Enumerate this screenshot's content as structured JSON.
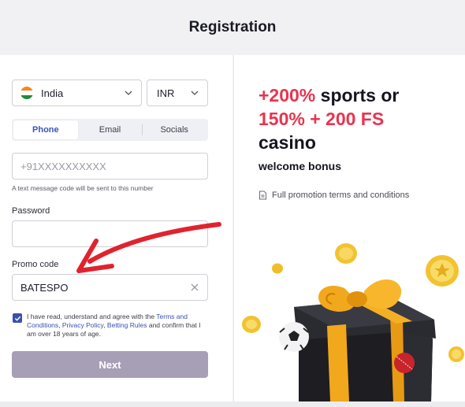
{
  "header": {
    "title": "Registration"
  },
  "country": {
    "value": "India",
    "flag": "india-flag-icon"
  },
  "currency": {
    "value": "INR"
  },
  "tabs": [
    {
      "label": "Phone",
      "active": true
    },
    {
      "label": "Email",
      "active": false
    },
    {
      "label": "Socials",
      "active": false
    }
  ],
  "phone": {
    "placeholder": "+91XXXXXXXXXX",
    "hint": "A text message code will be sent to this number"
  },
  "password": {
    "label": "Password",
    "value": ""
  },
  "promo": {
    "label": "Promo code",
    "value": "BATESPO"
  },
  "terms": {
    "checked": true,
    "prefix": "I have read, understand and agree with the ",
    "link_terms": "Terms and Conditions",
    "sep1": ", ",
    "link_privacy": "Privacy Policy",
    "sep2": ", ",
    "link_betting": "Betting Rules",
    "suffix": " and confirm that I am over 18 years of age."
  },
  "next_button": {
    "label": "Next"
  },
  "promotion": {
    "line1_red": "+200%",
    "line1_black": " sports or",
    "line2_red": "150% + 200 FS",
    "line3": "casino",
    "subtitle": "welcome bonus",
    "terms_link": "Full promotion terms and conditions"
  },
  "colors": {
    "accent_red": "#e8344f",
    "link_blue": "#3a4fb0",
    "button_disabled": "#a79fb6",
    "arrow_red": "#e0232e"
  }
}
